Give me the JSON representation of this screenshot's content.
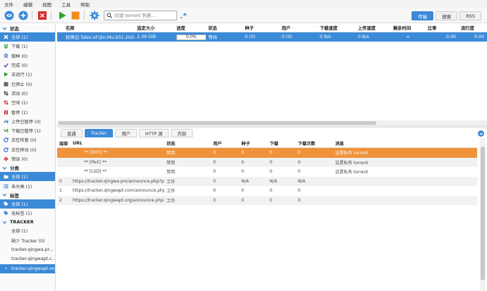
{
  "menu": [
    "文件",
    "编辑",
    "视图",
    "工具",
    "帮助"
  ],
  "toolbar": {
    "search_placeholder": "过滤 torrent 列表...",
    "view_tabs": [
      "传输",
      "搜索",
      "RSS"
    ]
  },
  "sidebar": {
    "status_header": "状态",
    "status_items": [
      {
        "label": "全部 (1)",
        "icon": "filter-all-icon",
        "color": "#e07020"
      },
      {
        "label": "下载 (1)",
        "icon": "download-icon",
        "color": "#2a9a2a"
      },
      {
        "label": "做种 (0)",
        "icon": "upload-icon",
        "color": "#3b6fd0"
      },
      {
        "label": "完成 (0)",
        "icon": "check-icon",
        "color": "#7a3fc0"
      },
      {
        "label": "正运行 (1)",
        "icon": "play-icon",
        "color": "#2a9a2a"
      },
      {
        "label": "已停止 (0)",
        "icon": "stop-icon",
        "color": "#666666"
      },
      {
        "label": "活动 (0)",
        "icon": "activity-icon",
        "color": "#333333"
      },
      {
        "label": "空闲 (1)",
        "icon": "idle-icon",
        "color": "#d03030"
      },
      {
        "label": "暂停 (1)",
        "icon": "pause-icon",
        "color": "#d03030"
      },
      {
        "label": "上传已暂停 (0)",
        "icon": "upload-paused-icon",
        "color": "#3b6fd0"
      },
      {
        "label": "下载已暂停 (1)",
        "icon": "download-paused-icon",
        "color": "#2a9a2a"
      },
      {
        "label": "正在检查 (0)",
        "icon": "checking-icon",
        "color": "#3b6fd0"
      },
      {
        "label": "正在移动 (0)",
        "icon": "moving-icon",
        "color": "#3b6fd0"
      },
      {
        "label": "错误 (0)",
        "icon": "error-icon",
        "color": "#d03030"
      }
    ],
    "category_header": "分类",
    "category_items": [
      {
        "label": "全部 (1)",
        "active": true
      },
      {
        "label": "未分类 (1)",
        "active": false
      }
    ],
    "tag_header": "标签",
    "tag_items": [
      {
        "label": "全部 (1)",
        "active": true
      },
      {
        "label": "无标签 (1)",
        "active": false
      }
    ],
    "tracker_header": "TRACKER",
    "tracker_items": [
      {
        "label": "全部 (1)",
        "active": false
      },
      {
        "label": "缺少 Tracker (0)",
        "active": false
      },
      {
        "label": "tracker.qingwa.pr...",
        "active": false
      },
      {
        "label": "tracker.qingwapt.c...",
        "active": false
      },
      {
        "label": "tracker.qingwapt.org",
        "active": true
      }
    ]
  },
  "torrents": {
    "columns": [
      "名称",
      "选定大小",
      "进度",
      "状态",
      "种子",
      "用户",
      "下载速度",
      "上传速度",
      "剩余时间",
      "比率",
      "流行度"
    ],
    "rows": [
      {
        "name": "秋神记.Tales.of.Qin.Mu.S01.2024....",
        "size": "2.39 GiB",
        "progress": "0.0%",
        "status": "等待",
        "seeds": "0 (0)",
        "peers": "0 (0)",
        "dl": "0 B/s",
        "ul": "0 B/s",
        "eta": "∞",
        "ratio": "0.00",
        "pop": "0.00"
      }
    ]
  },
  "detail_tabs": [
    "普通",
    "Tracker",
    "用户",
    "HTTP 源",
    "内容"
  ],
  "trackers": {
    "columns": [
      "层级",
      "URL",
      "状态",
      "用户",
      "种子",
      "下载",
      "下载次数",
      "消息"
    ],
    "rows": [
      {
        "tier": "",
        "url": "** [DHT] **",
        "status": "禁用",
        "peers": "0",
        "seeds": "0",
        "leeches": "0",
        "downloaded": "0",
        "msg": "这是私有 torrent"
      },
      {
        "tier": "",
        "url": "** [PeX] **",
        "status": "禁用",
        "peers": "0",
        "seeds": "0",
        "leeches": "0",
        "downloaded": "0",
        "msg": "这是私有 torrent"
      },
      {
        "tier": "",
        "url": "** [LSD] **",
        "status": "禁用",
        "peers": "0",
        "seeds": "0",
        "leeches": "0",
        "downloaded": "0",
        "msg": "这是私有 torrent"
      },
      {
        "tier": "0",
        "url": "https://tracker.qingwa.pro/announce.php?pa...",
        "status": "工作",
        "peers": "0",
        "seeds": "N/A",
        "leeches": "N/A",
        "downloaded": "N/A",
        "msg": ""
      },
      {
        "tier": "1",
        "url": "https://tracker.qingwapt.com/announce.php?...",
        "status": "工作",
        "peers": "0",
        "seeds": "0",
        "leeches": "0",
        "downloaded": "0",
        "msg": ""
      },
      {
        "tier": "2",
        "url": "https://tracker.qingwapt.org/announce.php?...",
        "status": "工作",
        "peers": "0",
        "seeds": "0",
        "leeches": "0",
        "downloaded": "0",
        "msg": ""
      }
    ]
  },
  "colors": {
    "accent": "#3b8ad8",
    "highlight": "#f0923a"
  }
}
